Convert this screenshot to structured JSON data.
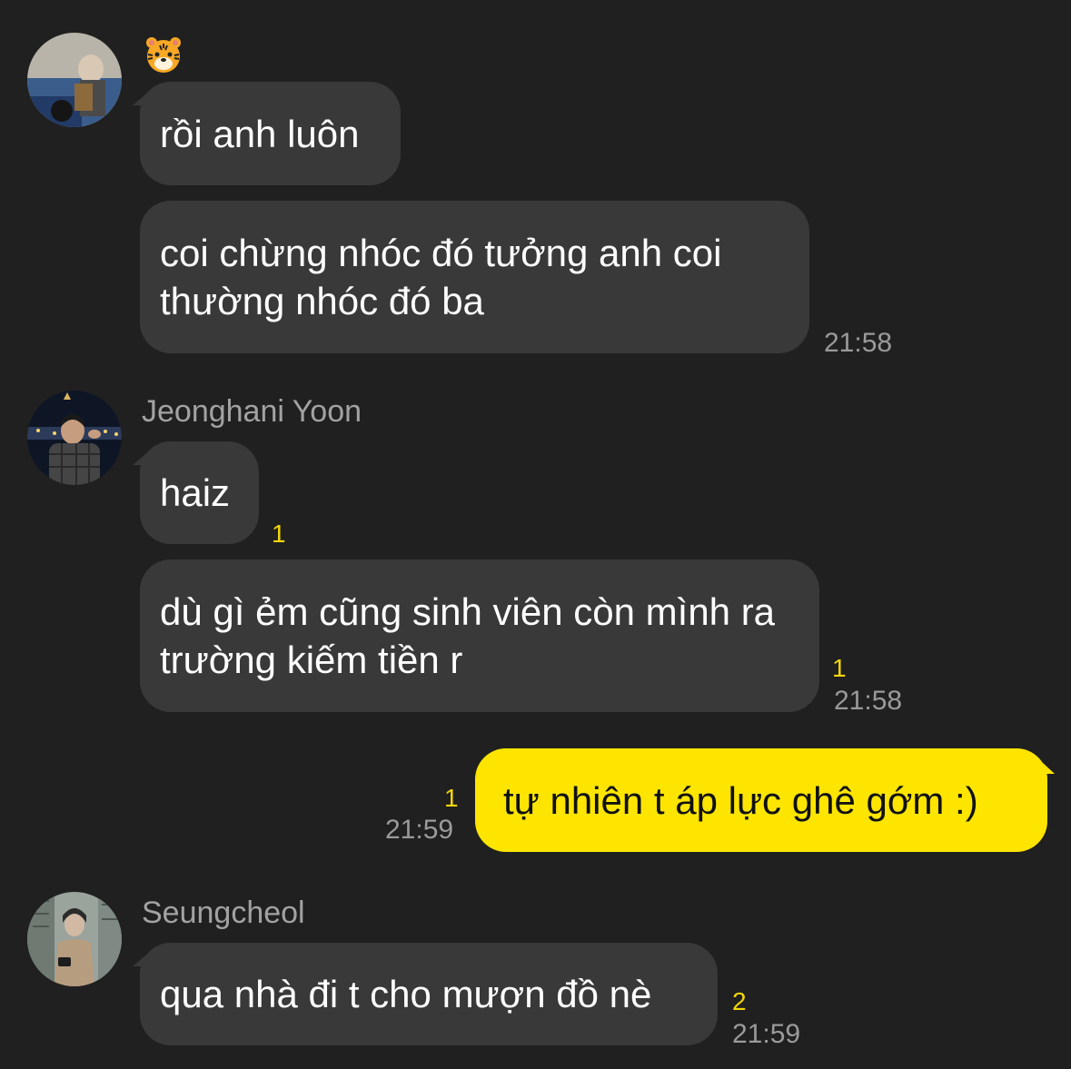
{
  "messages": [
    {
      "sender_emoji": "tiger-face",
      "bubbles": [
        {
          "text": "rồi anh luôn"
        },
        {
          "text": "coi chừng nhóc đó tưởng anh coi thường nhóc đó ba",
          "time": "21:58"
        }
      ]
    },
    {
      "sender": "Jeonghani Yoon",
      "bubbles": [
        {
          "text": "haiz",
          "unread": "1"
        },
        {
          "text": "dù gì ẻm cũng sinh viên còn mình ra trường kiếm tiền r",
          "unread": "1",
          "time": "21:58"
        }
      ]
    },
    {
      "mine": true,
      "bubbles": [
        {
          "text": "tự nhiên t áp lực ghê gớm :)",
          "unread": "1",
          "time": "21:59"
        }
      ]
    },
    {
      "sender": "Seungcheol",
      "bubbles": [
        {
          "text": "qua nhà đi t cho mượn đồ nè",
          "unread": "2",
          "time": "21:59"
        }
      ]
    }
  ],
  "colors": {
    "background": "#202020",
    "incoming_bubble": "#393939",
    "outgoing_bubble": "#fee500",
    "unread": "#f3d60a",
    "time": "#9a9a9a"
  },
  "icons": [
    "tiger-face",
    "avatar-photo"
  ]
}
